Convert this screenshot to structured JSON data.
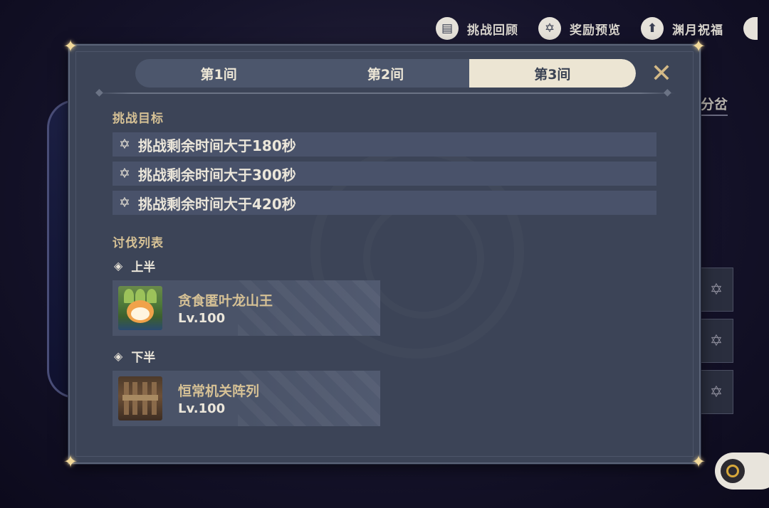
{
  "top_bar": {
    "buttons": [
      {
        "label": "挑战回顾",
        "icon": "book-icon"
      },
      {
        "label": "奖励预览",
        "icon": "star-icon"
      },
      {
        "label": "渊月祝福",
        "icon": "upload-icon"
      }
    ]
  },
  "background": {
    "right_text": "分岔"
  },
  "modal": {
    "tabs": [
      {
        "label": "第1间",
        "active": false
      },
      {
        "label": "第2间",
        "active": false
      },
      {
        "label": "第3间",
        "active": true
      }
    ],
    "close_icon": "close-icon",
    "goals": {
      "title": "挑战目标",
      "items": [
        "挑战剩余时间大于180秒",
        "挑战剩余时间大于300秒",
        "挑战剩余时间大于420秒"
      ]
    },
    "enemies": {
      "title": "讨伐列表",
      "halves": [
        {
          "label": "上半",
          "enemy": {
            "name": "贪食匿叶龙山王",
            "level": "Lv.100"
          }
        },
        {
          "label": "下半",
          "enemy": {
            "name": "恒常机关阵列",
            "level": "Lv.100"
          }
        }
      ]
    }
  },
  "colors": {
    "panel": "#3c4457",
    "accent_gold": "#d6c195",
    "tab_active": "#ece5d3"
  }
}
